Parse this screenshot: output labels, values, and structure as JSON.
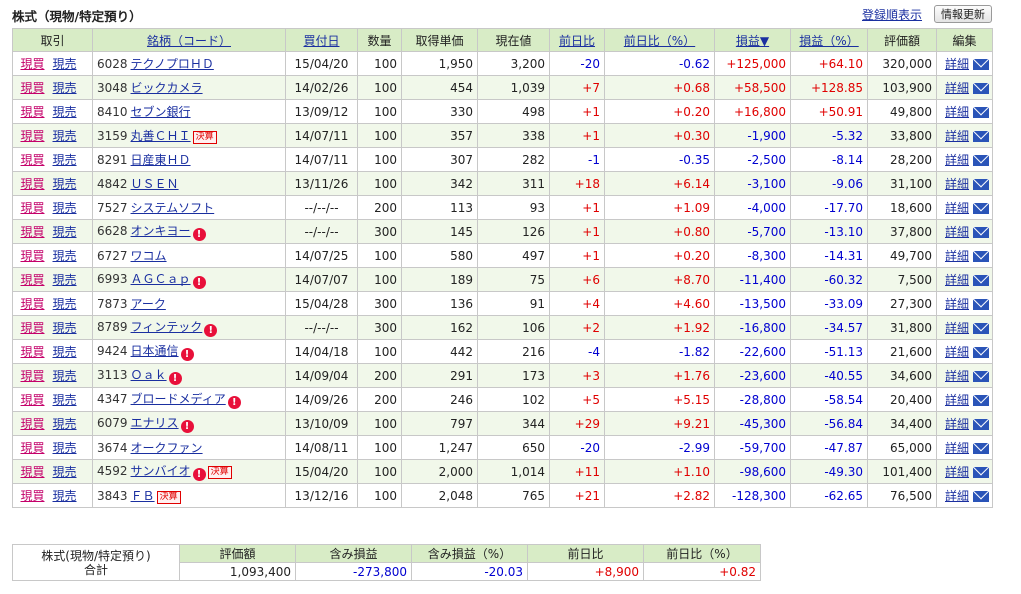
{
  "title": "株式（現物/特定預り）",
  "sort_link": "登録順表示",
  "refresh_button": "情報更新",
  "columns": [
    "取引",
    "銘柄（コード）",
    "買付日",
    "数量",
    "取得単価",
    "現在値",
    "前日比",
    "前日比（%）",
    "損益▼",
    "損益（%）",
    "評価額",
    "編集"
  ],
  "buy_label": "現買",
  "sell_label": "現売",
  "detail_label": "詳細",
  "rows": [
    {
      "code": "6028",
      "name": "テクノプロＨＤ",
      "date": "15/04/20",
      "qty": "100",
      "cost": "1,950",
      "price": "3,200",
      "chg": "-20",
      "chg_pct": "-0.62",
      "pl": "+125,000",
      "pl_pct": "+64.10",
      "value": "320,000",
      "badge": ""
    },
    {
      "code": "3048",
      "name": "ビックカメラ",
      "date": "14/02/26",
      "qty": "100",
      "cost": "454",
      "price": "1,039",
      "chg": "+7",
      "chg_pct": "+0.68",
      "pl": "+58,500",
      "pl_pct": "+128.85",
      "value": "103,900",
      "badge": ""
    },
    {
      "code": "8410",
      "name": "セブン銀行",
      "date": "13/09/12",
      "qty": "100",
      "cost": "330",
      "price": "498",
      "chg": "+1",
      "chg_pct": "+0.20",
      "pl": "+16,800",
      "pl_pct": "+50.91",
      "value": "49,800",
      "badge": ""
    },
    {
      "code": "3159",
      "name": "丸善ＣＨＩ",
      "date": "14/07/11",
      "qty": "100",
      "cost": "357",
      "price": "338",
      "chg": "+1",
      "chg_pct": "+0.30",
      "pl": "-1,900",
      "pl_pct": "-5.32",
      "value": "33,800",
      "badge": "決算"
    },
    {
      "code": "8291",
      "name": "日産東ＨＤ",
      "date": "14/07/11",
      "qty": "100",
      "cost": "307",
      "price": "282",
      "chg": "-1",
      "chg_pct": "-0.35",
      "pl": "-2,500",
      "pl_pct": "-8.14",
      "value": "28,200",
      "badge": ""
    },
    {
      "code": "4842",
      "name": "ＵＳＥＮ",
      "date": "13/11/26",
      "qty": "100",
      "cost": "342",
      "price": "311",
      "chg": "+18",
      "chg_pct": "+6.14",
      "pl": "-3,100",
      "pl_pct": "-9.06",
      "value": "31,100",
      "badge": ""
    },
    {
      "code": "7527",
      "name": "システムソフト",
      "date": "--/--/--",
      "qty": "200",
      "cost": "113",
      "price": "93",
      "chg": "+1",
      "chg_pct": "+1.09",
      "pl": "-4,000",
      "pl_pct": "-17.70",
      "value": "18,600",
      "badge": ""
    },
    {
      "code": "6628",
      "name": "オンキヨー",
      "date": "--/--/--",
      "qty": "300",
      "cost": "145",
      "price": "126",
      "chg": "+1",
      "chg_pct": "+0.80",
      "pl": "-5,700",
      "pl_pct": "-13.10",
      "value": "37,800",
      "badge": "!"
    },
    {
      "code": "6727",
      "name": "ワコム",
      "date": "14/07/25",
      "qty": "100",
      "cost": "580",
      "price": "497",
      "chg": "+1",
      "chg_pct": "+0.20",
      "pl": "-8,300",
      "pl_pct": "-14.31",
      "value": "49,700",
      "badge": ""
    },
    {
      "code": "6993",
      "name": "ＡＧＣａｐ",
      "date": "14/07/07",
      "qty": "100",
      "cost": "189",
      "price": "75",
      "chg": "+6",
      "chg_pct": "+8.70",
      "pl": "-11,400",
      "pl_pct": "-60.32",
      "value": "7,500",
      "badge": "!"
    },
    {
      "code": "7873",
      "name": "アーク",
      "date": "15/04/28",
      "qty": "300",
      "cost": "136",
      "price": "91",
      "chg": "+4",
      "chg_pct": "+4.60",
      "pl": "-13,500",
      "pl_pct": "-33.09",
      "value": "27,300",
      "badge": ""
    },
    {
      "code": "8789",
      "name": "フィンテック",
      "date": "--/--/--",
      "qty": "300",
      "cost": "162",
      "price": "106",
      "chg": "+2",
      "chg_pct": "+1.92",
      "pl": "-16,800",
      "pl_pct": "-34.57",
      "value": "31,800",
      "badge": "!"
    },
    {
      "code": "9424",
      "name": "日本通信",
      "date": "14/04/18",
      "qty": "100",
      "cost": "442",
      "price": "216",
      "chg": "-4",
      "chg_pct": "-1.82",
      "pl": "-22,600",
      "pl_pct": "-51.13",
      "value": "21,600",
      "badge": "!"
    },
    {
      "code": "3113",
      "name": "Ｏａｋ",
      "date": "14/09/04",
      "qty": "200",
      "cost": "291",
      "price": "173",
      "chg": "+3",
      "chg_pct": "+1.76",
      "pl": "-23,600",
      "pl_pct": "-40.55",
      "value": "34,600",
      "badge": "!"
    },
    {
      "code": "4347",
      "name": "ブロードメディア",
      "date": "14/09/26",
      "qty": "200",
      "cost": "246",
      "price": "102",
      "chg": "+5",
      "chg_pct": "+5.15",
      "pl": "-28,800",
      "pl_pct": "-58.54",
      "value": "20,400",
      "badge": "!"
    },
    {
      "code": "6079",
      "name": "エナリス",
      "date": "13/10/09",
      "qty": "100",
      "cost": "797",
      "price": "344",
      "chg": "+29",
      "chg_pct": "+9.21",
      "pl": "-45,300",
      "pl_pct": "-56.84",
      "value": "34,400",
      "badge": "!"
    },
    {
      "code": "3674",
      "name": "オークファン",
      "date": "14/08/11",
      "qty": "100",
      "cost": "1,247",
      "price": "650",
      "chg": "-20",
      "chg_pct": "-2.99",
      "pl": "-59,700",
      "pl_pct": "-47.87",
      "value": "65,000",
      "badge": ""
    },
    {
      "code": "4592",
      "name": "サンバイオ",
      "date": "15/04/20",
      "qty": "100",
      "cost": "2,000",
      "price": "1,014",
      "chg": "+11",
      "chg_pct": "+1.10",
      "pl": "-98,600",
      "pl_pct": "-49.30",
      "value": "101,400",
      "badge": "!+決算"
    },
    {
      "code": "3843",
      "name": "ＦＢ",
      "date": "13/12/16",
      "qty": "100",
      "cost": "2,048",
      "price": "765",
      "chg": "+21",
      "chg_pct": "+2.82",
      "pl": "-128,300",
      "pl_pct": "-62.65",
      "value": "76,500",
      "badge": "決算"
    }
  ],
  "summary": {
    "label_line1": "株式(現物/特定預り)",
    "label_line2": "合計",
    "headers": [
      "評価額",
      "含み損益",
      "含み損益（%）",
      "前日比",
      "前日比（%）"
    ],
    "values": [
      "1,093,400",
      "-273,800",
      "-20.03",
      "+8,900",
      "+0.82"
    ]
  },
  "colors": {
    "header_bg": "#d8ecc6",
    "positive": "#e00000",
    "negative": "#0000d0",
    "link": "#1a2fa0"
  }
}
